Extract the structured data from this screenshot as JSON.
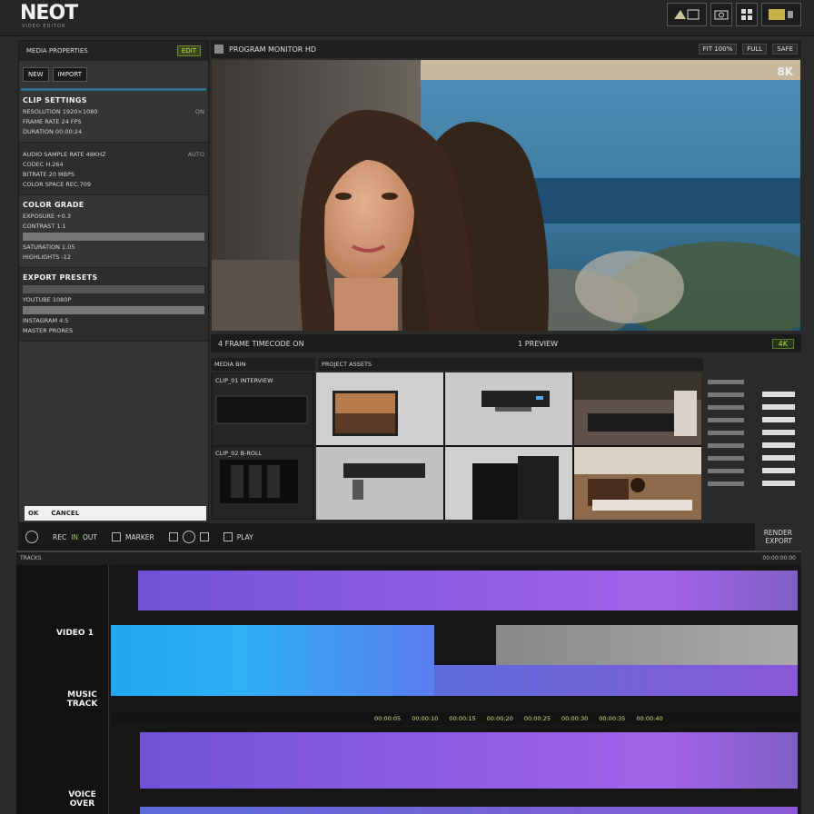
{
  "app": {
    "logo": "NEOT",
    "logo_sub": "VIDEO EDITOR"
  },
  "top_icons": [
    "effects-icon",
    "camera-icon",
    "grid-icon",
    "export-icon"
  ],
  "left_panel": {
    "header_title": "MEDIA PROPERTIES",
    "header_badge": "EDIT",
    "tabs": [
      "NEW",
      "IMPORT"
    ],
    "section1_title": "CLIP SETTINGS",
    "section1_rows": [
      {
        "label": "RESOLUTION 1920×1080",
        "value": "ON"
      },
      {
        "label": "FRAME RATE 24 FPS",
        "value": ""
      },
      {
        "label": "DURATION 00:00:24",
        "value": ""
      }
    ],
    "section2_rows": [
      {
        "label": "AUDIO SAMPLE RATE 48KHZ",
        "value": "AUTO"
      },
      {
        "label": "CODEC H.264",
        "value": ""
      },
      {
        "label": "BITRATE 20 MBPS",
        "value": ""
      },
      {
        "label": "COLOR SPACE REC.709",
        "value": ""
      }
    ],
    "section3_title": "COLOR GRADE",
    "section3_rows": [
      {
        "label": "EXPOSURE +0.3",
        "value": ""
      },
      {
        "label": "CONTRAST 1.1",
        "value": ""
      },
      {
        "label": "SATURATION 1.05",
        "value": ""
      },
      {
        "label": "HIGHLIGHTS -12",
        "value": ""
      }
    ],
    "section4_title": "EXPORT PRESETS",
    "section4_rows": [
      {
        "label": "YOUTUBE 1080P",
        "value": ""
      },
      {
        "label": "INSTAGRAM 4:5",
        "value": ""
      },
      {
        "label": "MASTER PRORES",
        "value": ""
      }
    ],
    "footer_left": "OK",
    "footer_right": "CANCEL"
  },
  "viewer": {
    "toolbar_title": "PROGRAM MONITOR HD",
    "toolbar_right_a": "FIT 100%",
    "toolbar_right_b": "FULL",
    "toolbar_right_c": "SAFE",
    "resolution_label": "8K",
    "info_left": "4 FRAME TIMECODE ON",
    "info_mid": "1 PREVIEW",
    "info_right": "4K"
  },
  "media": {
    "bin_title": "MEDIA BIN",
    "grid_title": "PROJECT ASSETS",
    "list_items": [
      "CLIP_01 INTERVIEW",
      "CLIP_02 B-ROLL"
    ]
  },
  "transport": {
    "btn_a": "REC",
    "btn_b": "IN",
    "btn_c": "OUT",
    "mode": "MARKER",
    "play_label": "PLAY",
    "end_top": "RENDER",
    "end_bottom": "EXPORT"
  },
  "timeline": {
    "ruler_left": "TRACKS",
    "ruler_right": "00:00:00:00",
    "track_labels": [
      "VIDEO 1",
      "MUSIC TRACK",
      "VOICE OVER"
    ],
    "green_strip": [
      "00:00:05",
      "00:00:10",
      "00:00:15",
      "00:00:20",
      "00:00:25",
      "00:00:30",
      "00:00:35",
      "00:00:40"
    ]
  },
  "colors": {
    "clip_purple": "#8a5ae2",
    "clip_blue": "#1fa8f0",
    "accent_green": "#9ad03a",
    "background": "#2b2b2b"
  }
}
